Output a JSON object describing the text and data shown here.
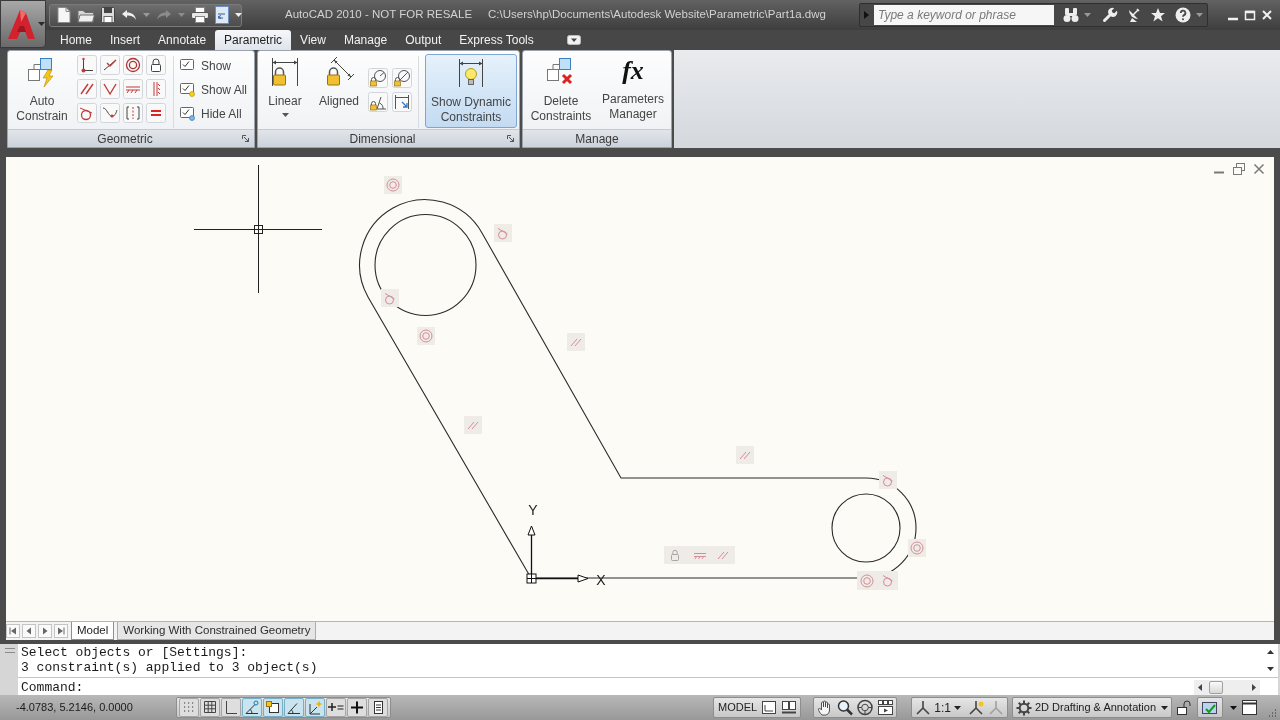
{
  "title_bar": {
    "app_title": "AutoCAD 2010 - NOT FOR RESALE",
    "file_path": "C:\\Users\\hp\\Documents\\Autodesk Website\\Parametric\\Part1a.dwg",
    "search_placeholder": "Type a keyword or phrase"
  },
  "ribbon_tabs": [
    {
      "label": "Home",
      "selected": false
    },
    {
      "label": "Insert",
      "selected": false
    },
    {
      "label": "Annotate",
      "selected": false
    },
    {
      "label": "Parametric",
      "selected": true
    },
    {
      "label": "View",
      "selected": false
    },
    {
      "label": "Manage",
      "selected": false
    },
    {
      "label": "Output",
      "selected": false
    },
    {
      "label": "Express Tools",
      "selected": false
    }
  ],
  "ribbon_panels": {
    "geometric": {
      "title": "Geometric",
      "auto_constrain": "Auto Constrain",
      "display_buttons": [
        "Show",
        "Show All",
        "Hide All"
      ]
    },
    "dimensional": {
      "title": "Dimensional",
      "linear": "Linear",
      "aligned": "Aligned",
      "dynamic_constraints": {
        "label": "Show Dynamic Constraints",
        "on": true
      }
    },
    "manage": {
      "title": "Manage",
      "buttons": [
        {
          "label": "Delete Constraints"
        },
        {
          "label": "Parameters Manager",
          "symbol": "fx"
        }
      ]
    }
  },
  "drawing": {
    "ucs": {
      "x_label": "X",
      "y_label": "Y"
    }
  },
  "layout_tabs": [
    {
      "label": "Model",
      "selected": true
    },
    {
      "label": "Working With Constrained Geometry",
      "selected": false
    }
  ],
  "command_line": {
    "history": [
      "Select objects or [Settings]:",
      "3 constraint(s) applied to 3 object(s)"
    ],
    "prompt": "Command:"
  },
  "status_bar": {
    "coordinates": "-4.0783, 5.2146, 0.0000",
    "toggles": [
      {
        "on": false
      },
      {
        "on": false
      },
      {
        "on": false
      },
      {
        "on": true
      },
      {
        "on": true
      },
      {
        "on": true
      },
      {
        "on": true
      },
      {
        "on": false
      },
      {
        "on": false
      },
      {
        "on": false
      }
    ],
    "space": "MODEL",
    "annotation_scale": "1:1",
    "workspace": "2D Drafting & Annotation"
  }
}
